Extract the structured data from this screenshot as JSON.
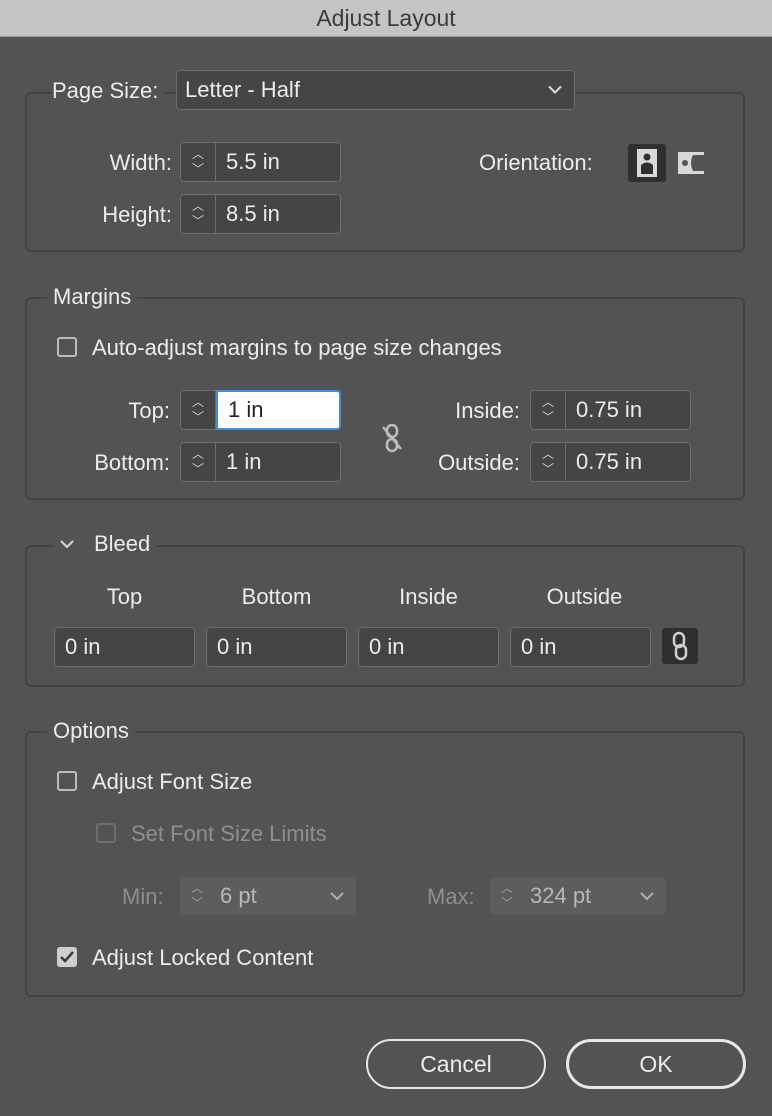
{
  "window": {
    "title": "Adjust Layout"
  },
  "page_size": {
    "label": "Page Size:",
    "selected": "Letter - Half",
    "width_label": "Width:",
    "width_value": "5.5 in",
    "height_label": "Height:",
    "height_value": "8.5 in",
    "orientation_label": "Orientation:"
  },
  "margins": {
    "legend": "Margins",
    "auto_adjust_label": "Auto-adjust margins to page size changes",
    "auto_adjust_checked": false,
    "top_label": "Top:",
    "top_value": "1 in",
    "bottom_label": "Bottom:",
    "bottom_value": "1 in",
    "inside_label": "Inside:",
    "inside_value": "0.75 in",
    "outside_label": "Outside:",
    "outside_value": "0.75 in"
  },
  "bleed": {
    "legend": "Bleed",
    "headers": [
      "Top",
      "Bottom",
      "Inside",
      "Outside"
    ],
    "values": [
      "0 in",
      "0 in",
      "0 in",
      "0 in"
    ]
  },
  "options": {
    "legend": "Options",
    "adjust_font_label": "Adjust Font Size",
    "adjust_font_checked": false,
    "set_limits_label": "Set Font Size Limits",
    "set_limits_checked": false,
    "min_label": "Min:",
    "min_value": "6 pt",
    "max_label": "Max:",
    "max_value": "324 pt",
    "locked_label": "Adjust Locked Content",
    "locked_checked": true
  },
  "buttons": {
    "cancel": "Cancel",
    "ok": "OK"
  },
  "icons": {
    "portrait": "portrait-orientation-icon",
    "landscape": "landscape-orientation-icon",
    "margin_link": "broken-link-icon",
    "bleed_link": "link-icon",
    "spinner": "spinner-arrows-icon",
    "chevron": "chevron-down-icon",
    "disclosure": "disclosure-triangle-icon"
  },
  "colors": {
    "dialog_bg": "#535353",
    "titlebar_bg": "#c4c4c4",
    "focus": "#3d8fd9"
  }
}
